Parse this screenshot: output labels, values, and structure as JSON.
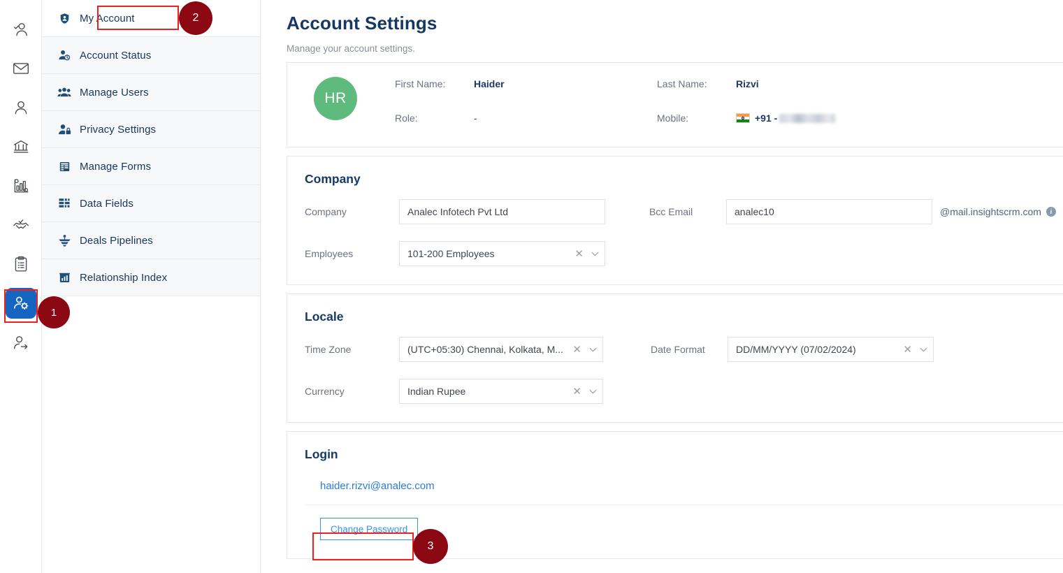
{
  "rail": {
    "items": [
      {
        "icon": "user-check-icon",
        "name": "rail-item-prospects",
        "active": false
      },
      {
        "icon": "envelope-icon",
        "name": "rail-item-mail",
        "active": false
      },
      {
        "icon": "user-icon",
        "name": "rail-item-contacts",
        "active": false
      },
      {
        "icon": "bank-icon",
        "name": "rail-item-institutions",
        "active": false
      },
      {
        "icon": "analytics-gear-icon",
        "name": "rail-item-analytics",
        "active": false
      },
      {
        "icon": "handshake-check-icon",
        "name": "rail-item-deals",
        "active": false
      },
      {
        "icon": "clipboard-list-icon",
        "name": "rail-item-reports",
        "active": false
      },
      {
        "icon": "user-gear-icon",
        "name": "rail-item-settings",
        "active": true
      },
      {
        "icon": "user-arrow-icon",
        "name": "rail-item-logout",
        "active": false
      }
    ]
  },
  "sidebar": {
    "items": [
      {
        "label": "My Account",
        "icon": "shield-user-icon"
      },
      {
        "label": "Account Status",
        "icon": "user-status-icon"
      },
      {
        "label": "Manage Users",
        "icon": "users-icon"
      },
      {
        "label": "Privacy Settings",
        "icon": "user-lock-icon"
      },
      {
        "label": "Manage Forms",
        "icon": "form-icon"
      },
      {
        "label": "Data Fields",
        "icon": "data-grid-icon"
      },
      {
        "label": "Deals Pipelines",
        "icon": "pipeline-icon"
      },
      {
        "label": "Relationship Index",
        "icon": "chart-building-icon"
      }
    ]
  },
  "header": {
    "title": "Account Settings",
    "subtitle": "Manage your account settings."
  },
  "profile": {
    "avatar_initials": "HR",
    "avatar_color": "#5fbb7d",
    "first_name_label": "First Name:",
    "first_name_value": "Haider",
    "last_name_label": "Last Name:",
    "last_name_value": "Rizvi",
    "role_label": "Role:",
    "role_value": "-",
    "mobile_label": "Mobile:",
    "mobile_country_code": "+91 -",
    "mobile_number_redacted": true
  },
  "company": {
    "title": "Company",
    "company_label": "Company",
    "company_value": "Analec Infotech Pvt Ltd",
    "bcc_email_label": "Bcc Email",
    "bcc_email_value": "analec10",
    "bcc_email_suffix": "@mail.insightscrm.com",
    "bcc_email_info_icon": "info-icon",
    "employees_label": "Employees",
    "employees_value": "101-200 Employees"
  },
  "locale": {
    "title": "Locale",
    "time_zone_label": "Time Zone",
    "time_zone_value": "(UTC+05:30) Chennai, Kolkata, M...",
    "date_format_label": "Date Format",
    "date_format_value": "DD/MM/YYYY (07/02/2024)",
    "currency_label": "Currency",
    "currency_value": "Indian Rupee"
  },
  "login": {
    "title": "Login",
    "email": "haider.rizvi@analec.com",
    "change_password_label": "Change Password"
  },
  "annotations": {
    "badge1": "1",
    "badge2": "2",
    "badge3": "3",
    "highlight_color": "#ef2020",
    "badge_color": "#8b0813"
  }
}
